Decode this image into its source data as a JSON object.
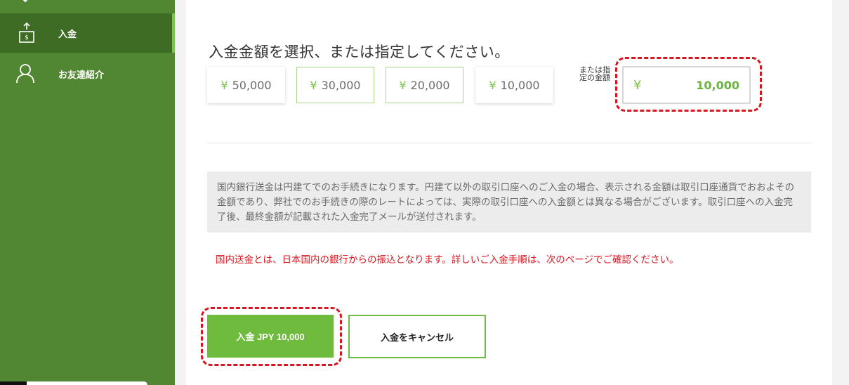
{
  "sidebar": {
    "items": [
      {
        "label": "入金",
        "icon": "deposit-icon"
      },
      {
        "label": "お友達紹介",
        "icon": "user-icon"
      }
    ]
  },
  "main": {
    "heading": "入金金額を選択、または指定してください。",
    "currency_symbol": "¥",
    "amount_options": [
      "50,000",
      "30,000",
      "20,000",
      "10,000"
    ],
    "alt_label": "または指定の金額",
    "custom_amount": "10,000",
    "notice": "国内銀行送金は円建てでのお手続きになります。円建て以外の取引口座へのご入金の場合、表示される金額は取引口座通貨でおおよその金額であり、弊社でのお手続きの際のレートによっては、実際の取引口座への入金額とは異なる場合がございます。取引口座への入金完了後、最終金額が記載された入金完了メールが送付されます。",
    "warning": "国内送金とは、日本国内の銀行からの振込となります。詳しいご入金手順は、次のページでご確認ください。",
    "submit_label": "入金 JPY 10,000",
    "cancel_label": "入金をキャンセル"
  },
  "colors": {
    "sidebar_bg": "#518732",
    "sidebar_active": "#3f6c25",
    "accent_green": "#6fbb3d",
    "highlight_red": "#d9161f"
  }
}
